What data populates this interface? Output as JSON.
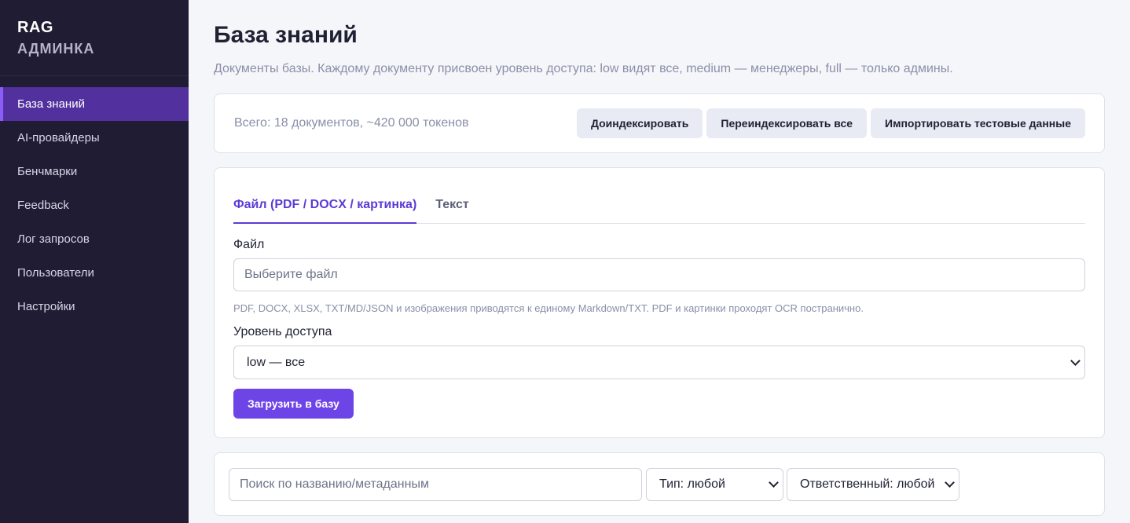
{
  "sidebar": {
    "brand_line1": "RAG",
    "brand_line2": "АДМИНКА",
    "items": [
      {
        "label": "База знаний",
        "active": true
      },
      {
        "label": "AI-провайдеры"
      },
      {
        "label": "Бенчмарки"
      },
      {
        "label": "Feedback"
      },
      {
        "label": "Лог запросов"
      },
      {
        "label": "Пользователи"
      },
      {
        "label": "Настройки"
      }
    ]
  },
  "header": {
    "title": "База знаний",
    "subtitle": "Документы базы. Каждому документу присвоен уровень доступа: low видят все, medium — менеджеры, full — только админы."
  },
  "stats": {
    "text": "Всего: 18 документов, ~420 000 токенов",
    "buttons": [
      "Доиндексировать",
      "Переиндексировать все",
      "Импортировать тестовые данные"
    ]
  },
  "upload": {
    "tabs": [
      {
        "label": "Файл (PDF / DOCX / картинка)",
        "active": true
      },
      {
        "label": "Текст"
      }
    ],
    "file_label": "Файл",
    "file_placeholder": "Выберите файл",
    "hint": "PDF, DOCX, XLSX, TXT/MD/JSON и изображения приводятся к единому Markdown/TXT. PDF и картинки проходят OCR постранично.",
    "access_label": "Уровень доступа",
    "access_value": "low — все",
    "submit_label": "Загрузить в базу"
  },
  "filters": {
    "search_placeholder": "Поиск по названию/метаданным",
    "type_value": "Тип: любой",
    "owner_value": "Ответственный: любой"
  },
  "colors": {
    "sidebar_bg": "#1f1c33",
    "active_item_bg": "#52319e",
    "accent": "#6d44e5",
    "tab_active": "#5b3bd6"
  }
}
